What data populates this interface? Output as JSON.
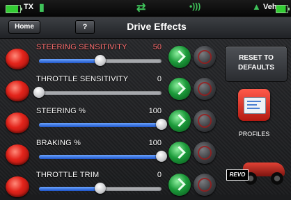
{
  "status_bar": {
    "tx_label": "TX",
    "veh_label": "Veh"
  },
  "header": {
    "home_label": "Home",
    "help_label": "?",
    "title": "Drive Effects"
  },
  "settings": [
    {
      "label": "STEERING SENSITIVITY",
      "value": "50",
      "level": 0.5,
      "highlight": true
    },
    {
      "label": "THROTTLE SENSITIVITY",
      "value": "0",
      "level": 0.0,
      "highlight": false
    },
    {
      "label": "STEERING %",
      "value": "100",
      "level": 1.0,
      "highlight": false
    },
    {
      "label": "BRAKING %",
      "value": "100",
      "level": 1.0,
      "highlight": false
    },
    {
      "label": "THROTTLE TRIM",
      "value": "0",
      "level": 0.5,
      "highlight": false
    }
  ],
  "side_panel": {
    "reset_line1": "RESET TO",
    "reset_line2": "DEFAULTS",
    "profiles_label": "PROFILES",
    "logo_text": "REVO"
  },
  "icons": {
    "tx_battery": "battery-icon",
    "tx_signal": "phone-icon",
    "link": "transfer-arrows-icon",
    "wireless": "signal-icon",
    "veh_battery": "battery-icon"
  },
  "colors": {
    "slider_fill": "#1f55c9",
    "highlight_text": "#ff6f6f",
    "increase_button": "#1c9a3a",
    "decrease_button": "#e3241b"
  }
}
